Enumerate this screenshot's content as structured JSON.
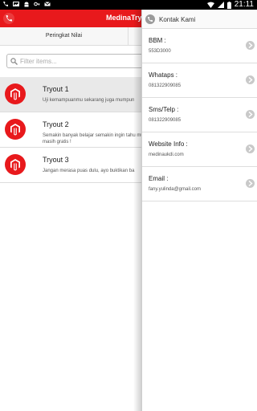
{
  "statusbar": {
    "time": "21:11"
  },
  "appbar": {
    "title": "MedinaTry"
  },
  "tabs": [
    {
      "label": "Peringkat Nilai"
    }
  ],
  "search": {
    "placeholder": "Filter items..."
  },
  "tryouts": [
    {
      "title": "Tryout 1",
      "desc": "Uji kemampuanmu sekarang juga mumpun"
    },
    {
      "title": "Tryout 2",
      "desc": "Semakin banyak belajar semakin ingin tahu mumpung masih gratis !"
    },
    {
      "title": "Tryout 3",
      "desc": "Jangan merasa puas dulu, ayo buktikan ba"
    }
  ],
  "drawer": {
    "title": "Kontak Kami",
    "contacts": [
      {
        "label": "BBM :",
        "value": "553D3000"
      },
      {
        "label": "Whataps :",
        "value": "081322909085"
      },
      {
        "label": "Sms/Telp :",
        "value": "081322909085"
      },
      {
        "label": "Website Info :",
        "value": "medinaukdi.com"
      },
      {
        "label": "Email :",
        "value": "fany.yulinda@gmail.com"
      }
    ]
  },
  "colors": {
    "accent": "#e8191c",
    "statusbar": "#000000"
  },
  "icons": {
    "statusbar_left": [
      "phone-icon",
      "picture-icon",
      "android-icon",
      "key-icon",
      "mail-icon"
    ],
    "statusbar_right": [
      "wifi-icon",
      "signal-icon",
      "battery-icon"
    ],
    "appbar": "phone-icon",
    "item_logo": "magento-logo-icon",
    "drawer_header": "phone-icon",
    "contact_arrow": "chevron-right-icon"
  }
}
